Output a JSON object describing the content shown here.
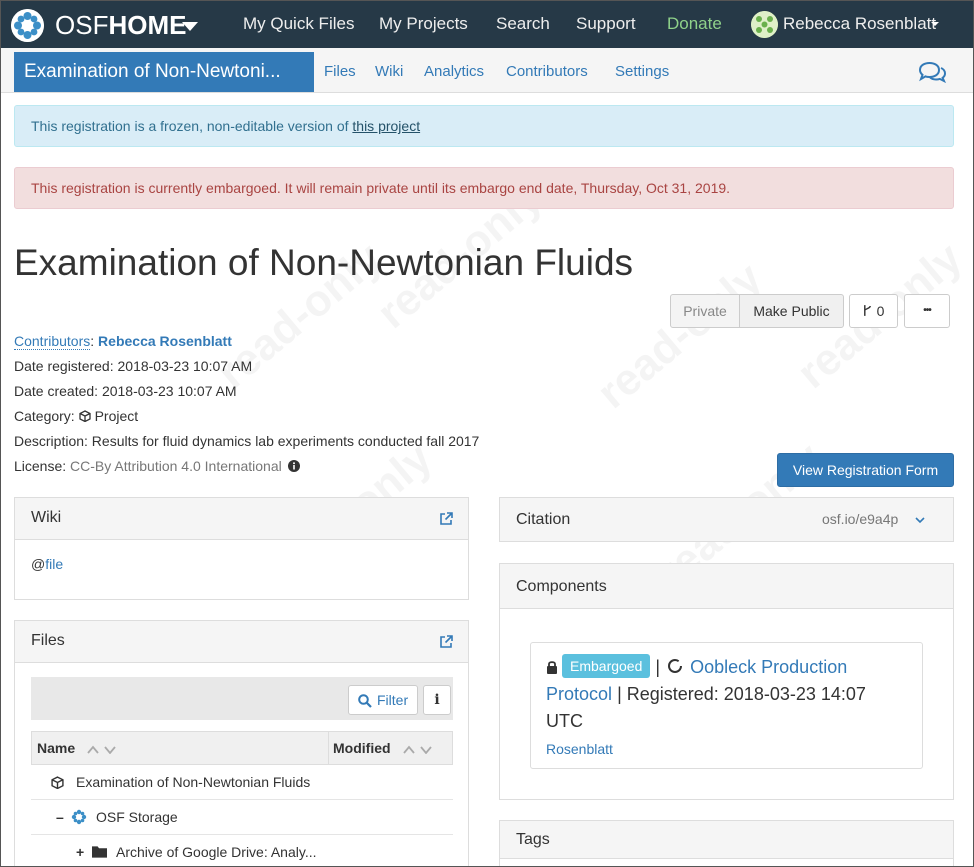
{
  "topnav": {
    "brand_prefix": "OSF",
    "brand_bold": "HOME",
    "links": [
      "My Quick Files",
      "My Projects",
      "Search",
      "Support",
      "Donate"
    ],
    "user_name": "Rebecca Rosenblatt",
    "logo_icon": "osf-logo-icon",
    "colors": {
      "background": "#263947",
      "donate": "#8fd18a"
    }
  },
  "subnav": {
    "project_title": "Examination of Non-Newtoni...",
    "tabs": [
      "Files",
      "Wiki",
      "Analytics",
      "Contributors",
      "Settings"
    ],
    "chat_icon": "comments-icon"
  },
  "alerts": {
    "info_text": "This registration is a frozen, non-editable version of ",
    "info_link": "this project",
    "danger_text": "This registration is currently embargoed. It will remain private until its embargo end date, Thursday, Oct 31, 2019."
  },
  "page": {
    "title": "Examination of Non-Newtonian Fluids",
    "watermark": "read-only"
  },
  "actions": {
    "private_label": "Private",
    "make_public_label": "Make Public",
    "fork_count": "0",
    "more_label": "•••",
    "view_form_label": "View Registration Form"
  },
  "meta": {
    "contributors_label": "Contributors",
    "contributor_name": "Rebecca Rosenblatt",
    "date_registered": "Date registered: 2018-03-23 10:07 AM",
    "date_created": "Date created: 2018-03-23 10:07 AM",
    "category_label": "Category: ",
    "category_value": "Project",
    "description": "Description: Results for fluid dynamics lab experiments conducted fall 2017",
    "license_label": "License: ",
    "license_value": "CC-By Attribution 4.0 International"
  },
  "wiki": {
    "heading": "Wiki",
    "content_prefix": "@",
    "content_link": "file"
  },
  "files": {
    "heading": "Files",
    "filter_label": "Filter",
    "info_label": "i",
    "columns": [
      "Name",
      "Modified"
    ],
    "rows": [
      {
        "name": "Examination of Non-Newtonian Fluids",
        "toggle": ""
      },
      {
        "name": "OSF Storage",
        "toggle": "–"
      },
      {
        "name": "Archive of Google Drive: Analy...",
        "toggle": "+"
      }
    ]
  },
  "citation": {
    "heading": "Citation",
    "value": "osf.io/e9a4p"
  },
  "components": {
    "heading": "Components",
    "badge": "Embargoed",
    "separator": "|",
    "title": "Oobleck Production Protocol",
    "registered": "| Registered: 2018-03-23 14:07 UTC",
    "contributor": "Rosenblatt"
  },
  "tags": {
    "heading": "Tags"
  }
}
